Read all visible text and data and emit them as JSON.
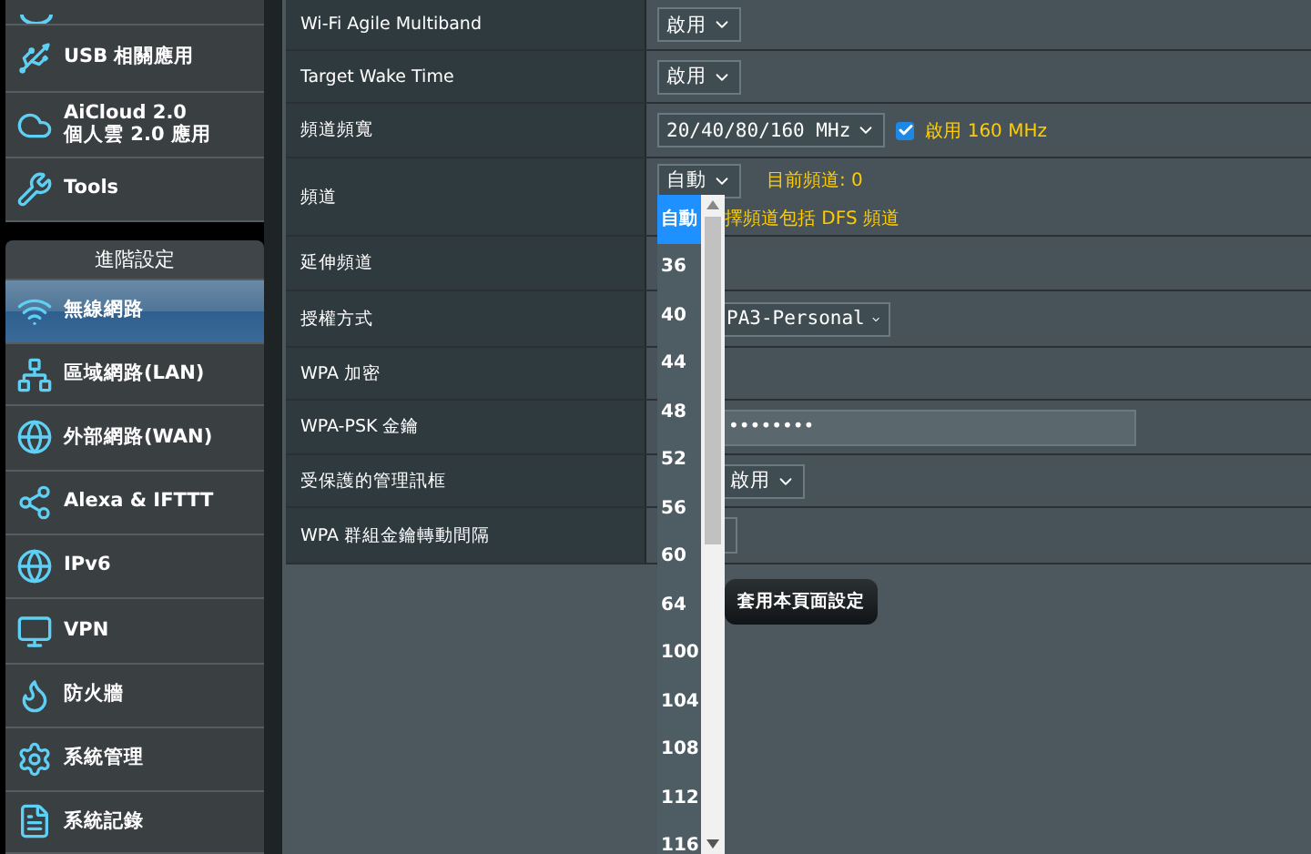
{
  "sidebar": {
    "items": [
      {
        "kind": "item",
        "label": "USB 相關應用",
        "selected": false
      },
      {
        "kind": "item",
        "label": "AiCloud 2.0\n個人雲 2.0 應用",
        "selected": false
      },
      {
        "kind": "item",
        "label": "Tools",
        "selected": false
      },
      {
        "kind": "header",
        "label": "進階設定"
      },
      {
        "kind": "item",
        "label": "無線網路",
        "selected": true
      },
      {
        "kind": "item",
        "label": "區域網路(LAN)",
        "selected": false
      },
      {
        "kind": "item",
        "label": "外部網路(WAN)",
        "selected": false
      },
      {
        "kind": "item",
        "label": "Alexa & IFTTT",
        "selected": false
      },
      {
        "kind": "item",
        "label": "IPv6",
        "selected": false
      },
      {
        "kind": "item",
        "label": "VPN",
        "selected": false
      },
      {
        "kind": "item",
        "label": "防火牆",
        "selected": false
      },
      {
        "kind": "item",
        "label": "系統管理",
        "selected": false
      },
      {
        "kind": "item",
        "label": "系統記錄",
        "selected": false
      }
    ]
  },
  "settings": [
    {
      "label": "Wi-Fi Agile Multiband",
      "kind": "select",
      "value": "啟用"
    },
    {
      "label": "Target Wake Time",
      "kind": "select",
      "value": "啟用"
    },
    {
      "label": "頻道頻寬",
      "kind": "select_check",
      "value": "20/40/80/160 MHz",
      "check_label": "啟用 160 MHz",
      "checked": true
    },
    {
      "label": "頻道",
      "kind": "channel",
      "value": "自動",
      "note": "目前頻道: 0",
      "note2": "擇頻道包括 DFS 頻道"
    },
    {
      "label": "延伸頻道",
      "kind": "empty"
    },
    {
      "label": "授權方式",
      "kind": "select_wide",
      "value": "PA3-Personal"
    },
    {
      "label": "WPA 加密",
      "kind": "empty"
    },
    {
      "label": "WPA-PSK 金鑰",
      "kind": "password",
      "value": "••••••••"
    },
    {
      "label": "受保護的管理訊框",
      "kind": "select_cut",
      "value": "啟用"
    },
    {
      "label": "WPA 群組金鑰轉動間隔",
      "kind": "small_input"
    }
  ],
  "apply_button": "套用本頁面設定",
  "channel_list": [
    {
      "label": "自動",
      "selected": true
    },
    {
      "label": "36",
      "selected": false
    },
    {
      "label": "40",
      "selected": false
    },
    {
      "label": "44",
      "selected": false
    },
    {
      "label": "48",
      "selected": false
    },
    {
      "label": "52",
      "selected": false
    },
    {
      "label": "56",
      "selected": false
    },
    {
      "label": "60",
      "selected": false
    },
    {
      "label": "64",
      "selected": false
    },
    {
      "label": "100",
      "selected": false
    },
    {
      "label": "104",
      "selected": false
    },
    {
      "label": "108",
      "selected": false
    },
    {
      "label": "112",
      "selected": false
    },
    {
      "label": "116",
      "selected": false
    }
  ]
}
